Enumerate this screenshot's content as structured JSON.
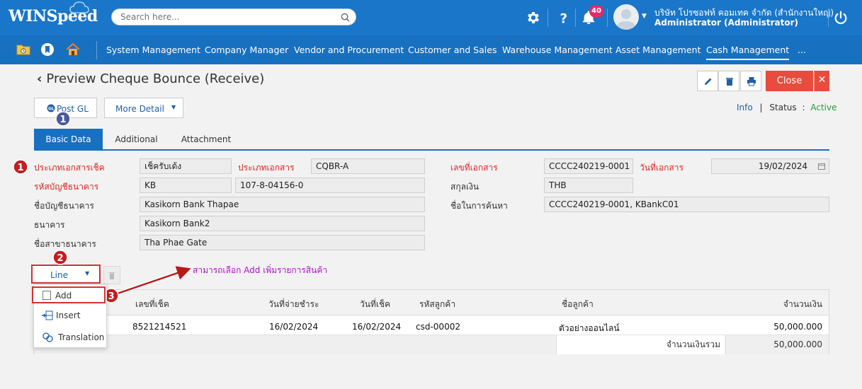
{
  "app": {
    "logo": "WINSpeed",
    "search_placeholder": "Search here...",
    "notification_count": "40",
    "company": "บริษัท โปรซอฟท์ คอมเทค จำกัด (สำนักงานใหญ่)",
    "user_role": "Administrator (Administrator)"
  },
  "menu": {
    "items": [
      "System Management",
      "Company Manager",
      "Vendor and Procurement",
      "Customer and Sales",
      "Warehouse Management",
      "Asset Management",
      "Cash Management",
      "..."
    ],
    "active": "Cash Management"
  },
  "page": {
    "title": "Preview Cheque Bounce (Receive)",
    "close_label": "Close",
    "post_gl_label": "Post GL",
    "more_detail_label": "More Detail",
    "info_label": "Info",
    "status_label": "Status",
    "status_value": "Active",
    "colors": {
      "primary": "#1870c0",
      "close": "#e84c3d",
      "required": "#e02424",
      "status_active": "#2a9a3a",
      "annotation": "#b012c8"
    }
  },
  "tabs": [
    "Basic Data",
    "Additional",
    "Attachment"
  ],
  "form": {
    "cheque_doc_type_label": "ประเภทเอกสารเช็ค",
    "cheque_doc_type_value": "เช็ครับเด้ง",
    "doc_type_label": "ประเภทเอกสาร",
    "doc_type_value": "CQBR-A",
    "doc_no_label": "เลขที่เอกสาร",
    "doc_no_value": "CCCC240219-0001",
    "doc_date_label": "วันที่เอกสาร",
    "doc_date_value": "19/02/2024",
    "bank_account_code_label": "รหัสบัญชีธนาคาร",
    "bank_account_code_value": "KB",
    "bank_account_no_value": "107-8-04156-0",
    "currency_label": "สกุลเงิน",
    "currency_value": "THB",
    "bank_account_name_label": "ชื่อบัญชีธนาคาร",
    "bank_account_name_value": "Kasikorn Bank Thapae",
    "search_name_label": "ชื่อในการค้นหา",
    "search_name_value": "CCCC240219-0001, KBankC01",
    "bank_label": "ธนาคาร",
    "bank_value": "Kasikorn Bank2",
    "branch_label": "ชื่อสาขาธนาคาร",
    "branch_value": "Tha Phae Gate"
  },
  "line_menu": {
    "button_label": "Line",
    "items": [
      "Add",
      "Insert",
      "Translation"
    ]
  },
  "annotation": {
    "text": "สามารถเลือก Add เพิ่มรายการสินค้า",
    "markers": [
      "1",
      "1",
      "2",
      "3"
    ]
  },
  "grid": {
    "headers": [
      "เลขที่เช็ค",
      "วันที่จ่ายชำระ",
      "วันที่เช็ค",
      "รหัสลูกค้า",
      "ชื่อลูกค้า",
      "จำนวนเงิน"
    ],
    "rows": [
      [
        "8521214521",
        "16/02/2024",
        "16/02/2024",
        "csd-00002",
        "ตัวอย่างออนไลน์",
        "50,000.000"
      ]
    ],
    "total_label": "จำนวนเงินรวม",
    "total_value": "50,000.000"
  }
}
